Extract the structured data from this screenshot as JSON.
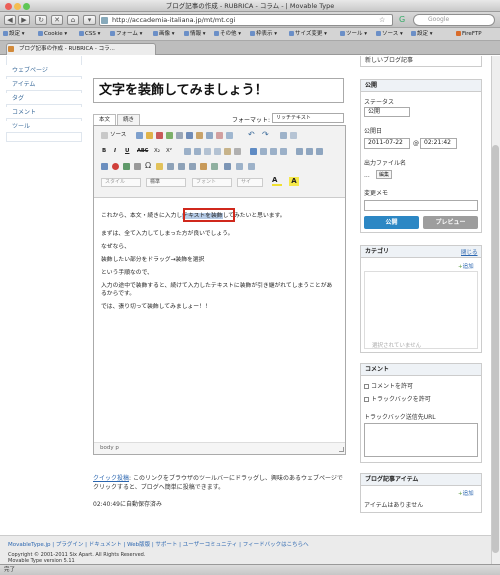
{
  "window": {
    "title": "ブログ記事の作成 - RUBRICA - コラム - | Movable Type"
  },
  "browser": {
    "url": "http://accademia-italiana.jp/mt/mt.cgi",
    "search_placeholder": "Google",
    "bookmarks": [
      "設定 ▾",
      "Cookie ▾",
      "CSS ▾",
      "フォーム ▾",
      "画像 ▾",
      "情報 ▾",
      "その他 ▾",
      "枠表示 ▾",
      "サイズ変更 ▾",
      "ツール ▾",
      "ソース ▾",
      "設定 ▾",
      "FireFTP"
    ],
    "tab_title": "ブログ記事の作成 - RUBRICA - コラ...",
    "status_text": "完了"
  },
  "sidebar": {
    "items": [
      "ウェブページ",
      "アイテム",
      "タグ",
      "コメント",
      "ツール"
    ]
  },
  "editor": {
    "title_value": "文字を装飾してみましょう！",
    "tab_body": "本文",
    "tab_more": "続き",
    "format_label": "フォーマット:",
    "format_value": "リッチテキスト",
    "toolbar": {
      "source_label": "ソース",
      "bold": "B",
      "italic": "I",
      "underline": "U",
      "strike": "ABC",
      "sub": "X₂",
      "sup": "X²",
      "style_select": "スタイル",
      "block_select": "標準",
      "font_select": "フォント",
      "size_select": "サイ"
    },
    "content": {
      "line1_before": "これから、本文・続きに入力し",
      "line1_highlight": "テキストを装飾",
      "line1_after": "してみたいと思います。",
      "line2": "まずは、全て入力してしまった方が良いでしょう。",
      "line3": "なぜなら、",
      "line4": "装飾したい部分をドラッグ→装飾を選択",
      "line5": "という手順なので、",
      "line6": "入力の途中で装飾すると、続けて入力したテキストに装飾が引き継がれてしまうことがあるからです。",
      "line7": "では、張り切って装飾してみましょー！！"
    },
    "status_path": "body  p"
  },
  "quickpost": {
    "link_text": "クイック投稿",
    "text": ": このリンクをブラウザのツールバーにドラッグし、興味のあるウェブページでクリックすると、ブログへ簡単に投稿できます。",
    "autosave": "02:40:49に自動保存済み"
  },
  "right": {
    "top_partial": "新しいブログ記事",
    "publish": {
      "header": "公開",
      "status_label": "ステータス",
      "status_value": "公開",
      "date_label": "公開日",
      "date_value": "2011-07-22",
      "at": "@",
      "time_value": "02:21:42",
      "basename_label": "出力ファイル名",
      "basename_value": "...",
      "edit_button": "編集",
      "memo_label": "変更メモ",
      "publish_button": "公開",
      "preview_button": "プレビュー"
    },
    "category": {
      "header": "カテゴリ",
      "close": "閉じる",
      "add": "追加",
      "empty": "選択されていません"
    },
    "comments": {
      "header": "コメント",
      "allow_comments": "コメントを許可",
      "allow_trackbacks": "トラックバックを許可",
      "trackback_label": "トラックバック送信先URL"
    },
    "items": {
      "header": "ブログ記事アイテム",
      "add": "追加",
      "empty": "アイテムはありません"
    }
  },
  "footer": {
    "links": "MovableType.jp  |  プラグイン  |  ドキュメント  |  Web版版  |  サポート  |  ユーザーコミュニティ  |  フィードバックはこちらへ",
    "copyright": "Copyright © 2001-2011 Six Apart. All Rights Reserved.",
    "version": "Movable Type version 5.11"
  },
  "colors": {
    "accent": "#2c87c4",
    "highlight_box": "#d0281c",
    "selection": "#b5cbe6"
  }
}
